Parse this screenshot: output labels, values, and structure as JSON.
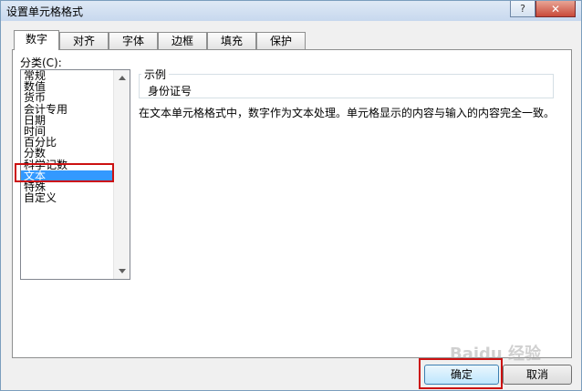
{
  "window": {
    "title": "设置单元格格式",
    "help_glyph": "?",
    "close_glyph": "✕"
  },
  "tabs": [
    "数字",
    "对齐",
    "字体",
    "边框",
    "填充",
    "保护"
  ],
  "category": {
    "label": "分类(C):",
    "items": [
      "常规",
      "数值",
      "货币",
      "会计专用",
      "日期",
      "时间",
      "百分比",
      "分数",
      "科学记数",
      "文本",
      "特殊",
      "自定义"
    ],
    "selected": "文本"
  },
  "sample": {
    "legend": "示例",
    "value": "身份证号"
  },
  "description": "在文本单元格格式中，数字作为文本处理。单元格显示的内容与输入的内容完全一致。",
  "buttons": {
    "ok": "确定",
    "cancel": "取消"
  },
  "watermark": "Baidu 经验",
  "colors": {
    "selection": "#3399ff",
    "annotation": "#cc1111"
  }
}
